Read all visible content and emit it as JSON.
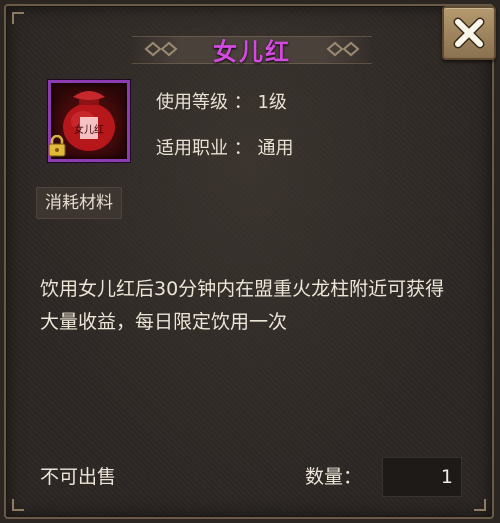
{
  "item": {
    "name": "女儿红",
    "level_line": "使用等级 ： 1级",
    "class_line": "适用职业 ： 通用",
    "category": "消耗材料",
    "description": "饮用女儿红后30分钟内在盟重火龙柱附近可获得大量收益，每日限定饮用一次",
    "locked": true,
    "icon": "wine-jar-icon",
    "icon_text": "女儿红"
  },
  "footer": {
    "sell_status": "不可出售",
    "quantity_label": "数量：",
    "quantity_value": "1"
  },
  "colors": {
    "title": "#d34ae0",
    "icon_border": "#8c3bb0",
    "text": "#ece5d8",
    "panel_bg": "#2c2724"
  }
}
